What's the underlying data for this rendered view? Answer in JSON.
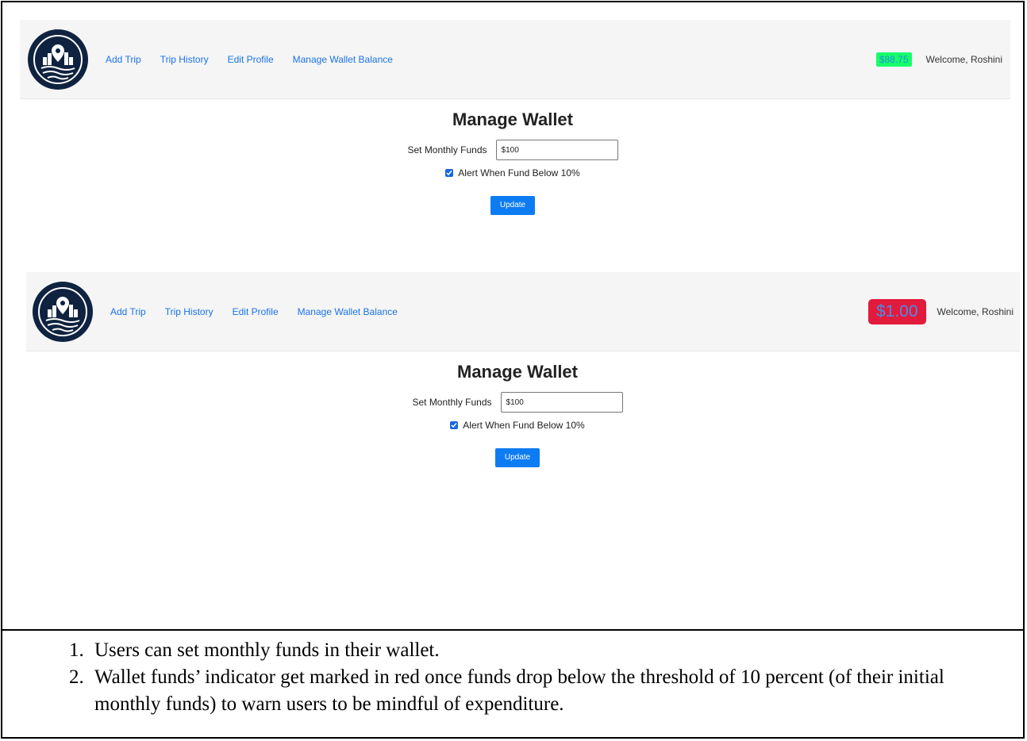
{
  "nav": {
    "links": [
      "Add Trip",
      "Trip History",
      "Edit Profile",
      "Manage Wallet Balance"
    ],
    "welcome": "Welcome, Roshini"
  },
  "screen1": {
    "balance": "$88.75",
    "balance_color": "#16ff6a"
  },
  "screen2": {
    "balance": "$1.00",
    "balance_color": "#e21b3c"
  },
  "form": {
    "title": "Manage Wallet",
    "funds_label": "Set Monthly Funds",
    "funds_value": "$100",
    "alert_label": "Alert When Fund Below 10%",
    "alert_checked": true,
    "update_label": "Update"
  },
  "caption": {
    "items": [
      "Users can set monthly funds in their wallet.",
      "Wallet funds’ indicator get marked in red once funds drop below the threshold of 10 percent (of their initial monthly funds) to warn users to be mindful of expenditure."
    ]
  },
  "icons": {
    "logo": "map-pin-city-icon",
    "checkbox": "checkmark-icon"
  },
  "colors": {
    "link": "#1a73e8",
    "nav_bg": "#f5f5f5",
    "logo_bg": "#0f2340",
    "button": "#0d7cf2"
  }
}
